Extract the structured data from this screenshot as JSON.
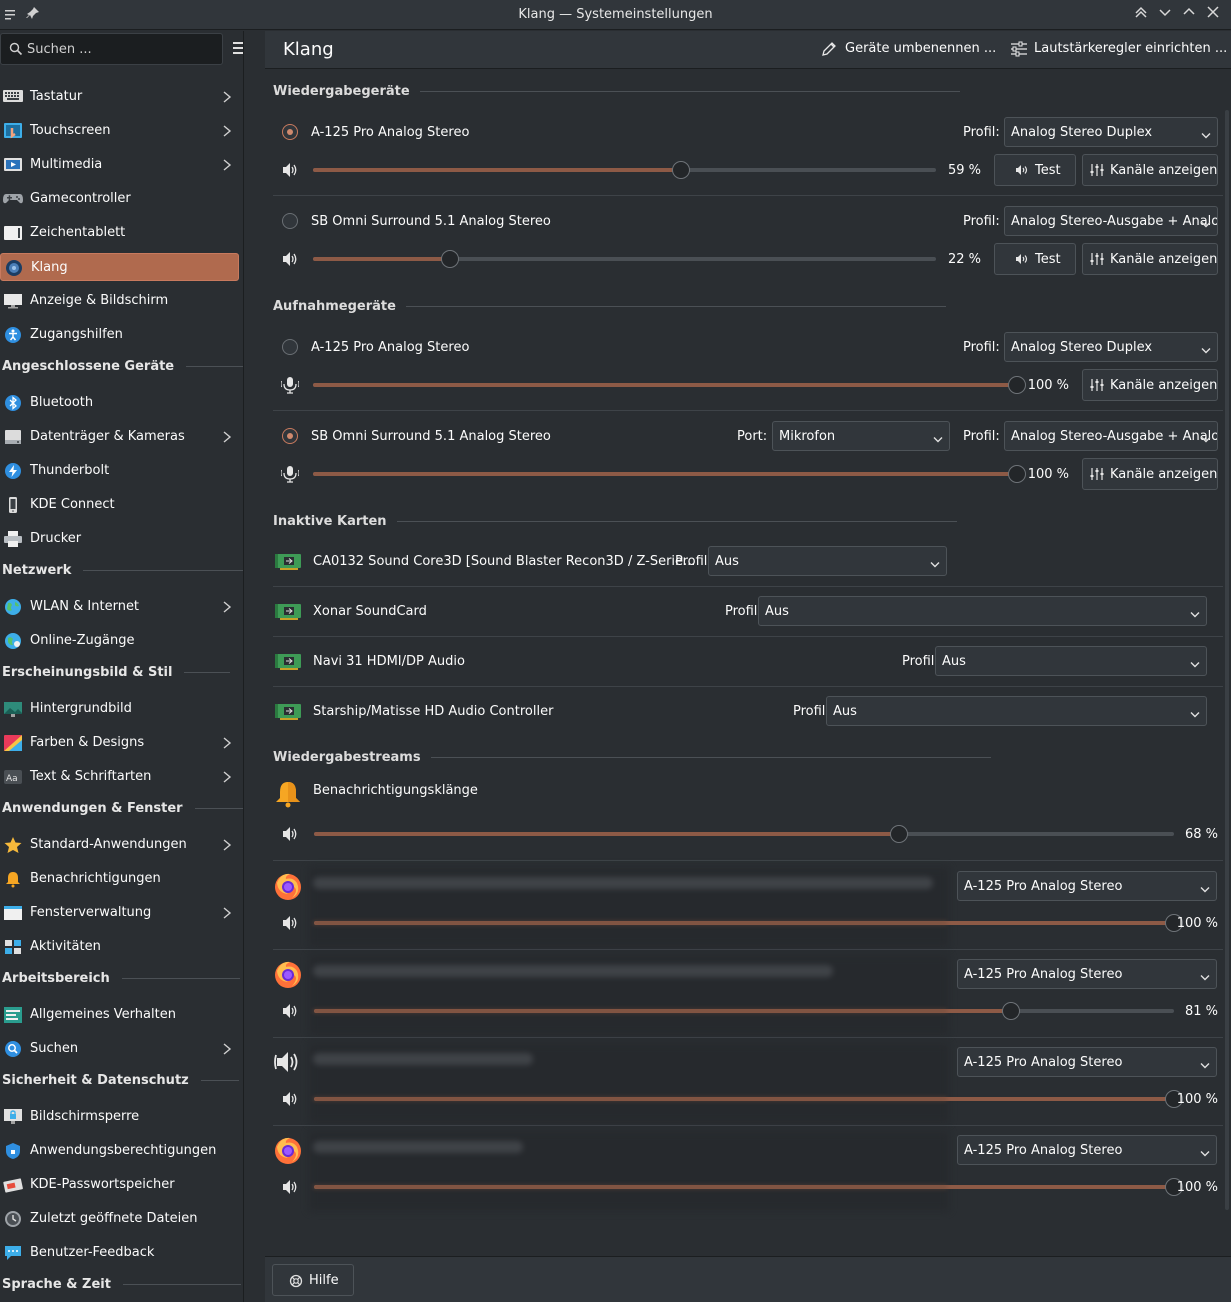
{
  "window": {
    "title": "Klang — Systemeinstellungen"
  },
  "search": {
    "placeholder": "Suchen ..."
  },
  "header": {
    "title": "Klang",
    "rename_label": "Geräte umbenennen ...",
    "volume_label": "Lautstärkeregler einrichten ..."
  },
  "sidebar": {
    "items": [
      {
        "label": "Tastatur",
        "chevron": true,
        "icon": "keyboard-icon"
      },
      {
        "label": "Touchscreen",
        "chevron": true,
        "icon": "touchscreen-icon"
      },
      {
        "label": "Multimedia",
        "chevron": true,
        "icon": "multimedia-icon"
      },
      {
        "label": "Gamecontroller",
        "chevron": false,
        "icon": "gamepad-icon"
      },
      {
        "label": "Zeichentablett",
        "chevron": false,
        "icon": "tablet-icon"
      },
      {
        "label": "Klang",
        "chevron": false,
        "icon": "speaker-icon",
        "selected": true
      },
      {
        "label": "Anzeige & Bildschirm",
        "chevron": false,
        "icon": "display-icon"
      },
      {
        "label": "Zugangshilfen",
        "chevron": false,
        "icon": "accessibility-icon"
      }
    ],
    "sections": [
      {
        "title": "Angeschlossene Geräte",
        "items": [
          {
            "label": "Bluetooth",
            "chevron": false,
            "icon": "bluetooth-icon"
          },
          {
            "label": "Datenträger & Kameras",
            "chevron": true,
            "icon": "drive-icon"
          },
          {
            "label": "Thunderbolt",
            "chevron": false,
            "icon": "thunderbolt-icon"
          },
          {
            "label": "KDE Connect",
            "chevron": false,
            "icon": "phone-icon"
          },
          {
            "label": "Drucker",
            "chevron": false,
            "icon": "printer-icon"
          }
        ]
      },
      {
        "title": "Netzwerk",
        "items": [
          {
            "label": "WLAN & Internet",
            "chevron": true,
            "icon": "globe-icon"
          },
          {
            "label": "Online-Zugänge",
            "chevron": false,
            "icon": "online-accounts-icon"
          }
        ]
      },
      {
        "title": "Erscheinungsbild & Stil",
        "items": [
          {
            "label": "Hintergrundbild",
            "chevron": false,
            "icon": "wallpaper-icon"
          },
          {
            "label": "Farben & Designs",
            "chevron": true,
            "icon": "colors-icon"
          },
          {
            "label": "Text & Schriftarten",
            "chevron": true,
            "icon": "font-icon"
          }
        ]
      },
      {
        "title": "Anwendungen & Fenster",
        "items": [
          {
            "label": "Standard-Anwendungen",
            "chevron": true,
            "icon": "star-icon"
          },
          {
            "label": "Benachrichtigungen",
            "chevron": false,
            "icon": "bell-icon"
          },
          {
            "label": "Fensterverwaltung",
            "chevron": true,
            "icon": "window-icon"
          },
          {
            "label": "Aktivitäten",
            "chevron": false,
            "icon": "activities-icon"
          }
        ]
      },
      {
        "title": "Arbeitsbereich",
        "items": [
          {
            "label": "Allgemeines Verhalten",
            "chevron": false,
            "icon": "general-icon"
          },
          {
            "label": "Suchen",
            "chevron": true,
            "icon": "search-icon"
          }
        ]
      },
      {
        "title": "Sicherheit & Datenschutz",
        "items": [
          {
            "label": "Bildschirmsperre",
            "chevron": false,
            "icon": "lock-screen-icon"
          },
          {
            "label": "Anwendungsberechtigungen",
            "chevron": false,
            "icon": "shield-icon"
          },
          {
            "label": "KDE-Passwortspeicher",
            "chevron": false,
            "icon": "wallet-icon"
          },
          {
            "label": "Zuletzt geöffnete Dateien",
            "chevron": false,
            "icon": "clock-icon"
          },
          {
            "label": "Benutzer-Feedback",
            "chevron": false,
            "icon": "feedback-icon"
          }
        ]
      },
      {
        "title": "Sprache & Zeit",
        "items": []
      }
    ]
  },
  "playback": {
    "title": "Wiedergabegeräte",
    "devices": [
      {
        "name": "A-125 Pro Analog Stereo",
        "active": true,
        "profile_label": "Profil:",
        "profile": "Analog Stereo Duplex",
        "volume": 59,
        "volume_text": "59 %",
        "test": "Test",
        "channels": "Kanäle anzeigen"
      },
      {
        "name": "SB Omni Surround 5.1 Analog Stereo",
        "active": false,
        "profile_label": "Profil:",
        "profile": "Analog Stereo-Ausgabe + Analog",
        "volume": 22,
        "volume_text": "22 %",
        "test": "Test",
        "channels": "Kanäle anzeigen"
      }
    ]
  },
  "recording": {
    "title": "Aufnahmegeräte",
    "devices": [
      {
        "name": "A-125 Pro Analog Stereo",
        "active": false,
        "profile_label": "Profil:",
        "profile": "Analog Stereo Duplex",
        "volume": 100,
        "volume_text": "100 %",
        "channels": "Kanäle anzeigen"
      },
      {
        "name": "SB Omni Surround 5.1 Analog Stereo",
        "active": true,
        "port_label": "Port:",
        "port": "Mikrofon",
        "profile_label": "Profil:",
        "profile": "Analog Stereo-Ausgabe + Analog",
        "volume": 100,
        "volume_text": "100 %",
        "channels": "Kanäle anzeigen"
      }
    ]
  },
  "inactive": {
    "title": "Inaktive Karten",
    "cards": [
      {
        "name": "CA0132 Sound Core3D [Sound Blaster Recon3D / Z-Serie...",
        "profile_label": "Profil:",
        "profile": "Aus"
      },
      {
        "name": "Xonar SoundCard",
        "profile_label": "Profil:",
        "profile": "Aus"
      },
      {
        "name": "Navi 31 HDMI/DP Audio",
        "profile_label": "Profil:",
        "profile": "Aus"
      },
      {
        "name": "Starship/Matisse HD Audio Controller",
        "profile_label": "Profil:",
        "profile": "Aus"
      }
    ]
  },
  "streams": {
    "title": "Wiedergabestreams",
    "notification": {
      "name": "Benachrichtigungsklänge",
      "volume": 68,
      "volume_text": "68 %"
    },
    "apps": [
      {
        "icon": "firefox-icon",
        "device": "A-125 Pro Analog Stereo",
        "volume": 100,
        "volume_text": "100 %"
      },
      {
        "icon": "firefox-icon",
        "device": "A-125 Pro Analog Stereo",
        "volume": 81,
        "volume_text": "81 %"
      },
      {
        "icon": "speaker-icon",
        "device": "A-125 Pro Analog Stereo",
        "volume": 100,
        "volume_text": "100 %"
      },
      {
        "icon": "firefox-icon",
        "device": "A-125 Pro Analog Stereo",
        "volume": 100,
        "volume_text": "100 %"
      }
    ]
  },
  "footer": {
    "help": "Hilfe"
  },
  "colors": {
    "accent": "#b06a4e",
    "slider_fill": "#8d5a46",
    "background": "#2a2e32"
  }
}
